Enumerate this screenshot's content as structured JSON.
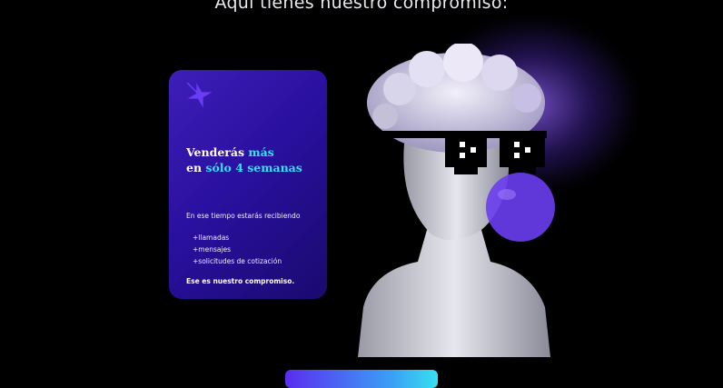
{
  "header": {
    "heading": "Aquí tienes nuestro compromiso:"
  },
  "card": {
    "title_line1_prefix": "Venderás ",
    "title_line1_accent": "más",
    "title_line2_prefix": "en ",
    "title_line2_accent": "sólo 4 semanas",
    "intro": "En ese tiempo estarás recibiendo",
    "items": [
      "+llamadas",
      "+mensajes",
      "+solicitudes de cotización"
    ],
    "commitment": "Ese es nuestro compromiso."
  },
  "colors": {
    "background": "#000000",
    "card_start": "#3d1fb8",
    "card_end": "#1a0a6e",
    "accent_cyan": "#36e0f5",
    "bubble": "#6a3df0"
  },
  "icons": [
    "sparkle-icon",
    "statue-image",
    "pixel-sunglasses",
    "bubblegum-bubble"
  ]
}
